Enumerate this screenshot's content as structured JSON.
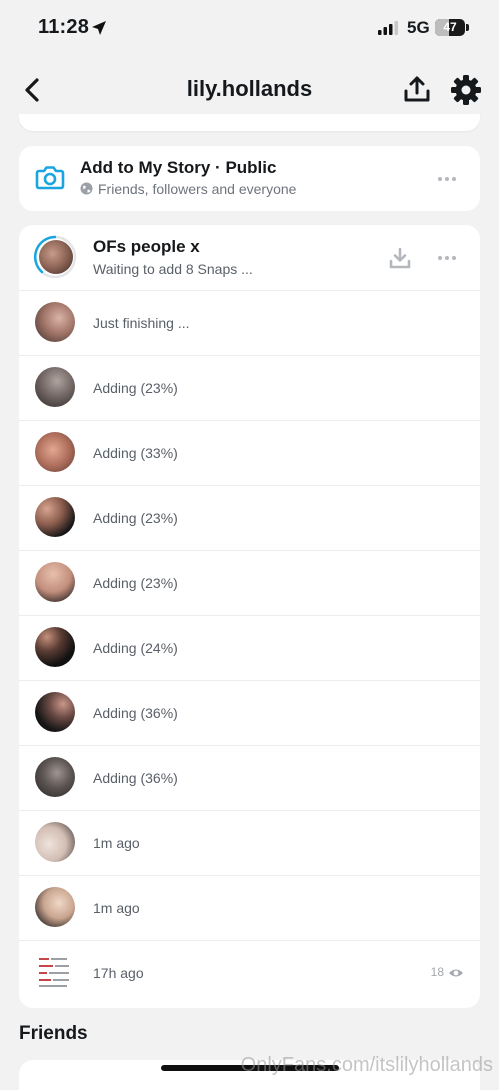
{
  "status_bar": {
    "time": "11:28",
    "network": "5G",
    "battery": "47",
    "battery_level": 0.47
  },
  "header": {
    "title": "lily.hollands"
  },
  "my_story": {
    "title": "Add to My Story · Public",
    "subtitle": "Friends, followers and everyone"
  },
  "group_story": {
    "title": "OFs people x",
    "subtitle": "Waiting to add 8 Snaps ..."
  },
  "snaps": [
    {
      "status": "Just finishing ..."
    },
    {
      "status": "Adding (23%)"
    },
    {
      "status": "Adding (33%)"
    },
    {
      "status": "Adding (23%)"
    },
    {
      "status": "Adding (23%)"
    },
    {
      "status": "Adding (24%)"
    },
    {
      "status": "Adding (36%)"
    },
    {
      "status": "Adding (36%)"
    },
    {
      "status": "1m ago"
    },
    {
      "status": "1m ago"
    },
    {
      "status": "17h ago",
      "views": "18"
    }
  ],
  "sections": {
    "friends": "Friends"
  },
  "watermark": "OnlyFans.com/itslilyhollands",
  "colors": {
    "accent": "#19a6e0",
    "background": "#f2f2f3",
    "card": "#ffffff",
    "secondary_text": "#5a6068"
  }
}
